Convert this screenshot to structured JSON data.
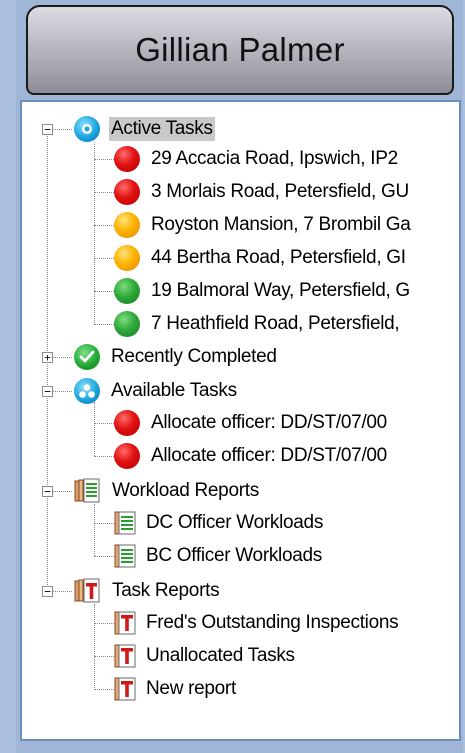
{
  "header": {
    "title": "Gillian Palmer"
  },
  "tree": {
    "active": {
      "label": "Active Tasks",
      "expander": "−",
      "items": [
        {
          "label": "29 Accacia Road, Ipswich, IP2",
          "status": "red"
        },
        {
          "label": "3 Morlais Road, Petersfield, GU",
          "status": "red"
        },
        {
          "label": "Royston Mansion, 7 Brombil Ga",
          "status": "amber"
        },
        {
          "label": "44 Bertha Road, Petersfield, GI",
          "status": "amber"
        },
        {
          "label": "19 Balmoral Way, Petersfield, G",
          "status": "green"
        },
        {
          "label": "7 Heathfield Road, Petersfield,",
          "status": "green"
        }
      ]
    },
    "completed": {
      "label": "Recently Completed",
      "expander": "+"
    },
    "available": {
      "label": "Available Tasks",
      "expander": "−",
      "items": [
        {
          "label": "Allocate officer: DD/ST/07/00",
          "status": "red"
        },
        {
          "label": "Allocate officer: DD/ST/07/00",
          "status": "red"
        }
      ]
    },
    "workload": {
      "label": "Workload Reports",
      "expander": "−",
      "items": [
        {
          "label": "DC Officer Workloads"
        },
        {
          "label": "BC Officer Workloads"
        }
      ]
    },
    "taskreports": {
      "label": "Task Reports",
      "expander": "−",
      "items": [
        {
          "label": "Fred's Outstanding Inspections"
        },
        {
          "label": "Unallocated Tasks"
        },
        {
          "label": "New report"
        }
      ]
    }
  },
  "colors": {
    "status_red": "#e01010",
    "status_amber": "#ffb300",
    "status_green": "#2eaa3a",
    "selection": "#c9c9c9",
    "panel_border": "#6b8fc0"
  }
}
